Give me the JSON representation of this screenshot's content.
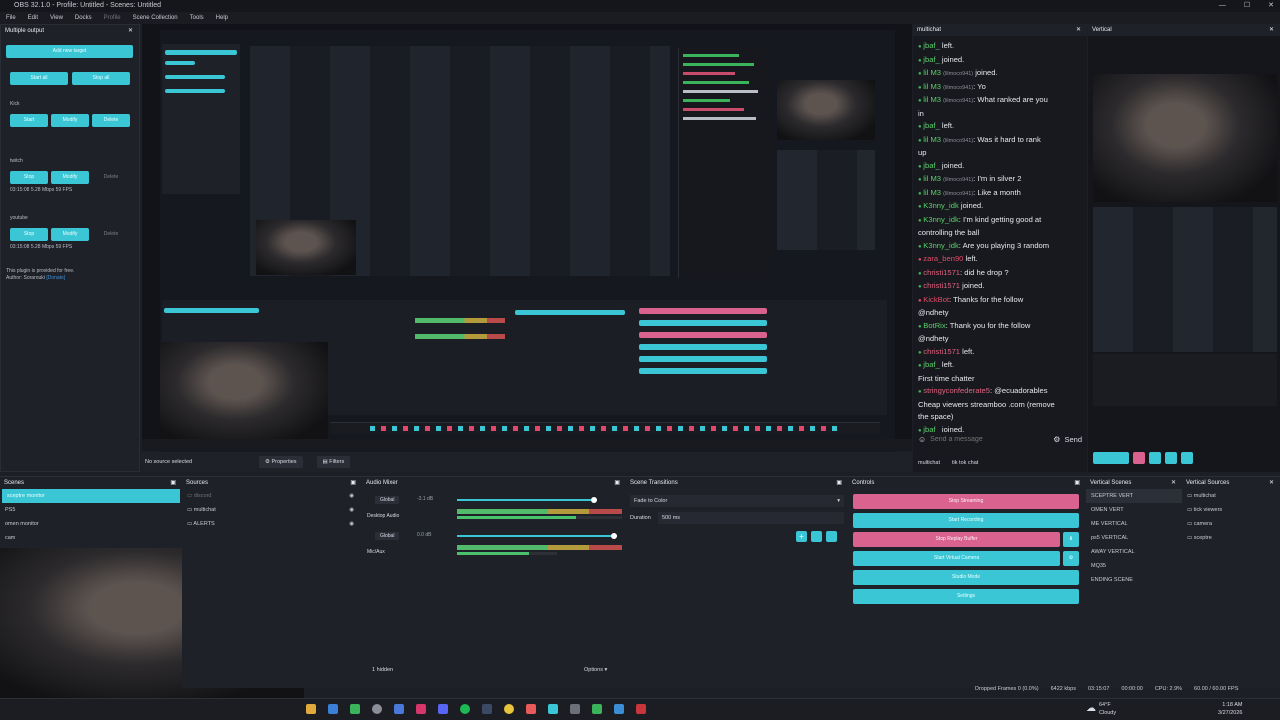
{
  "window": {
    "title": "OBS 32.1.0 - Profile: Untitled - Scenes: Untitled",
    "minimize": "—",
    "maximize": "☐",
    "close": "✕"
  },
  "menu": [
    "File",
    "Edit",
    "View",
    "Docks",
    "Profile",
    "Scene Collection",
    "Tools",
    "Help"
  ],
  "multiple_output": {
    "title": "Multiple output",
    "add_target": "Add new target",
    "start_all": "Start all",
    "stop_all": "Stop all",
    "targets": [
      {
        "name": "Kick",
        "buttons": [
          "Start",
          "Modify",
          "Delete"
        ],
        "status": ""
      },
      {
        "name": "twitch",
        "buttons": [
          "Stop",
          "Modify",
          "Delete"
        ],
        "status": "03:15:08  5.28 Mbps  59 FPS"
      },
      {
        "name": "youtube",
        "buttons": [
          "Stop",
          "Modify",
          "Delete"
        ],
        "status": "03:15:08  5.28 Mbps  59 FPS"
      }
    ],
    "footer1": "This plugin is provided for free.",
    "footer2": "Author: Sorarouki",
    "footer_link": "[Donate]"
  },
  "no_source": "No source selected",
  "properties": "Properties",
  "filters": "Filters",
  "multichat": {
    "title": "multichat",
    "lines": [
      {
        "user": "jbaf_",
        "text": " left.",
        "color": "green"
      },
      {
        "user": "jbaf_",
        "text": " joined.",
        "color": "green"
      },
      {
        "user": "lil M3",
        "tag": "(lilmoco941)",
        "text": " joined.",
        "color": "green"
      },
      {
        "user": "lil M3",
        "tag": "(lilmoco941)",
        "text": ": Yo",
        "color": "green"
      },
      {
        "user": "lil M3",
        "tag": "(lilmoco941)",
        "text": ": What ranked are you",
        "color": "green"
      },
      {
        "user": "",
        "text": "in",
        "color": "none"
      },
      {
        "user": "jbaf_",
        "text": " left.",
        "color": "green"
      },
      {
        "user": "lil M3",
        "tag": "(lilmoco941)",
        "text": ": Was it hard to rank",
        "color": "green"
      },
      {
        "user": "",
        "text": "up",
        "color": "none"
      },
      {
        "user": "jbaf_",
        "text": " joined.",
        "color": "green"
      },
      {
        "user": "lil M3",
        "tag": "(lilmoco941)",
        "text": ": I'm in silver 2",
        "color": "green"
      },
      {
        "user": "lil M3",
        "tag": "(lilmoco941)",
        "text": ": Like a month",
        "color": "green"
      },
      {
        "user": "K3nny_idk",
        "text": " joined.",
        "color": "green"
      },
      {
        "user": "K3nny_idk",
        "text": ": I'm kind getting good at",
        "color": "green"
      },
      {
        "user": "",
        "text": "controlling the ball",
        "color": "none"
      },
      {
        "user": "K3nny_idk",
        "text": ": Are you playing 3 random",
        "color": "green"
      },
      {
        "user": "zara_ben90",
        "text": " left.",
        "color": "red"
      },
      {
        "user": "christi1571",
        "text": ": did he drop ?",
        "color": "pink"
      },
      {
        "user": "christi1571",
        "text": " joined.",
        "color": "pink"
      },
      {
        "user": "KickBot",
        "text": ": Thanks for the follow",
        "color": "red"
      },
      {
        "user": "",
        "text": "@ndhety",
        "color": "none"
      },
      {
        "user": "BotRix",
        "text": ": Thank you for the follow",
        "color": "green"
      },
      {
        "user": "",
        "text": "@ndhety",
        "color": "none"
      },
      {
        "user": "christi1571",
        "text": " left.",
        "color": "pink"
      },
      {
        "user": "jbaf_",
        "text": " left.",
        "color": "green"
      },
      {
        "user": "",
        "text": "First time chatter",
        "color": "none"
      },
      {
        "user": "stringyconfederate5",
        "text": ": @ecuadorables",
        "color": "pink"
      },
      {
        "user": "",
        "text": "Cheap viewers streamboo .com (remove",
        "color": "none"
      },
      {
        "user": "",
        "text": "the space)",
        "color": "none"
      },
      {
        "user": "jbaf_",
        "text": " joined.",
        "color": "green"
      }
    ],
    "placeholder": "Send a message",
    "send": "Send",
    "tabs": [
      "multichat",
      "tik tok chat"
    ]
  },
  "vertical": {
    "title": "Vertical"
  },
  "scenes": {
    "title": "Scenes",
    "items": [
      "sceptre monitor",
      "PS5",
      "omen monitor",
      "cam"
    ]
  },
  "sources": {
    "title": "Sources",
    "items": [
      "discord",
      "multichat",
      "ALERTS"
    ]
  },
  "audio_mixer": {
    "title": "Audio Mixer",
    "channels": [
      {
        "global": "Global",
        "name": "Desktop Audio",
        "db": "-3.1 dB"
      },
      {
        "global": "Global",
        "name": "Mic/Aux",
        "db": "0.0 dB"
      }
    ],
    "ticks": [
      "-60",
      "-55",
      "-50",
      "-45",
      "-40",
      "-35",
      "-30",
      "-25",
      "-20",
      "-15",
      "-10",
      "-5",
      "0"
    ],
    "hidden": "1 hidden",
    "options": "Options"
  },
  "transitions": {
    "title": "Scene Transitions",
    "selected": "Fade to Color",
    "duration_label": "Duration",
    "duration": "500 ms"
  },
  "controls": {
    "title": "Controls",
    "stop_streaming": "Stop Streaming",
    "start_recording": "Start Recording",
    "stop_replay": "Stop Replay Buffer",
    "start_virtual": "Start Virtual Camera",
    "studio_mode": "Studio Mode",
    "settings": "Settings"
  },
  "vertical_scenes": {
    "title": "Vertical Scenes",
    "items": [
      "SCEPTRE VERT",
      "OMEN VERT",
      "ME VERTICAL",
      "ps5 VERTICAL",
      "AWAY VERTICAL",
      "MQ35",
      "ENDING SCENE"
    ]
  },
  "vertical_sources": {
    "title": "Vertical Sources",
    "items": [
      "multichat",
      "tick viewers",
      "camera",
      "sceptre"
    ]
  },
  "status": {
    "dropped": "Dropped Frames 0 (0.0%)",
    "kbps": "6422 kbps",
    "time": "03:15:07",
    "rec": "00:00:00",
    "cpu": "CPU: 2.9%",
    "fps": "60.00 / 60.00 FPS"
  },
  "taskbar": {
    "weather_temp": "64°F",
    "weather_desc": "Cloudy",
    "clock_time": "1:18 AM",
    "clock_date": "3/27/2026"
  },
  "colors": {
    "accent": "#3bc6d6",
    "pink": "#d9628f"
  }
}
